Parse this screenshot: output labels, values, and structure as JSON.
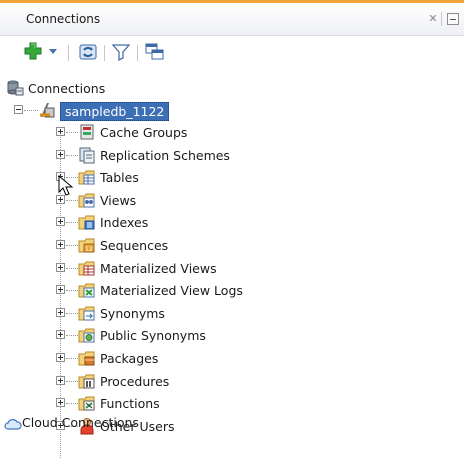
{
  "panel": {
    "title": "Connections"
  },
  "toolbar": {
    "items": [
      "add-connection",
      "dropdown",
      "refresh",
      "filter",
      "schema-browser"
    ]
  },
  "tree": {
    "root_label": "Connections",
    "connection": {
      "label": "sampledb_1122",
      "selected": true
    },
    "children": [
      {
        "label": "Cache Groups",
        "icon": "cache-groups-icon"
      },
      {
        "label": "Replication Schemes",
        "icon": "replication-schemes-icon"
      },
      {
        "label": "Tables",
        "icon": "tables-icon"
      },
      {
        "label": "Views",
        "icon": "views-icon"
      },
      {
        "label": "Indexes",
        "icon": "indexes-icon"
      },
      {
        "label": "Sequences",
        "icon": "sequences-icon"
      },
      {
        "label": "Materialized Views",
        "icon": "materialized-views-icon"
      },
      {
        "label": "Materialized View Logs",
        "icon": "materialized-view-logs-icon"
      },
      {
        "label": "Synonyms",
        "icon": "synonyms-icon"
      },
      {
        "label": "Public Synonyms",
        "icon": "public-synonyms-icon"
      },
      {
        "label": "Packages",
        "icon": "packages-icon"
      },
      {
        "label": "Procedures",
        "icon": "procedures-icon"
      },
      {
        "label": "Functions",
        "icon": "functions-icon"
      },
      {
        "label": "Other Users",
        "icon": "other-users-icon"
      }
    ],
    "cloud_label": "Cloud Connections"
  },
  "colors": {
    "accent": "#f0a43a",
    "selection": "#3d6fb6"
  }
}
